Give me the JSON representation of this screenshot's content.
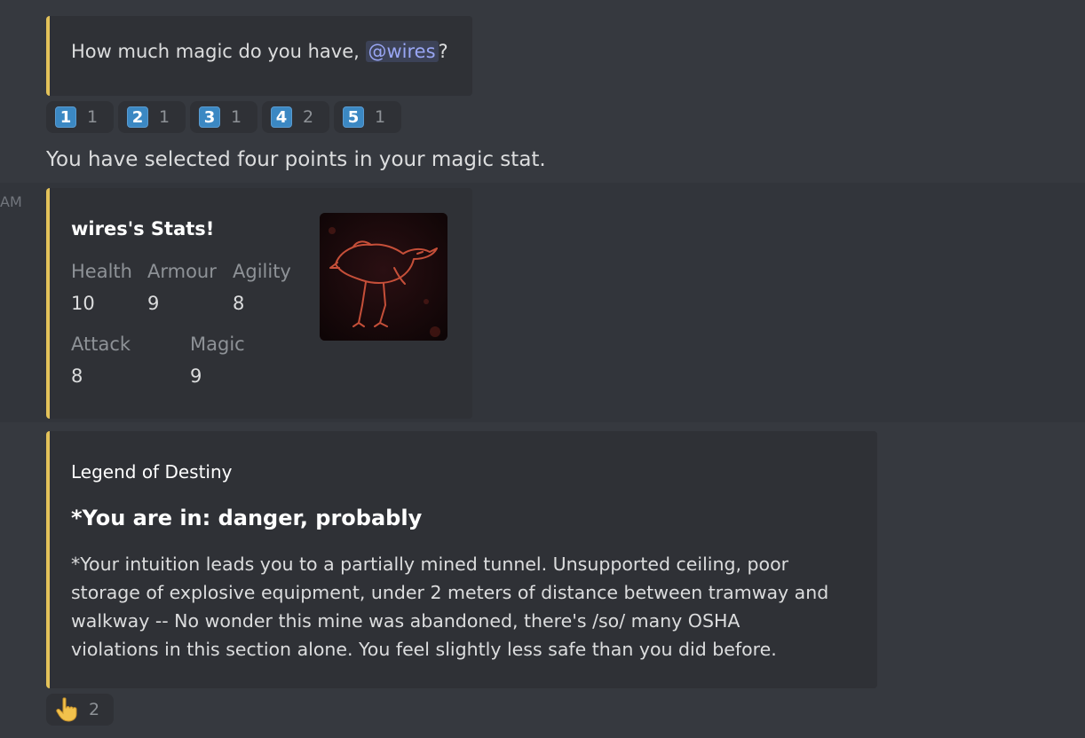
{
  "top_cut_text": "...",
  "question": {
    "text_before": "How much magic do you have, ",
    "mention": "@wires",
    "text_after": "?"
  },
  "number_reactions": [
    {
      "emoji": "1",
      "count": "1"
    },
    {
      "emoji": "2",
      "count": "1"
    },
    {
      "emoji": "3",
      "count": "1"
    },
    {
      "emoji": "4",
      "count": "2"
    },
    {
      "emoji": "5",
      "count": "1"
    }
  ],
  "selection_message": "You have selected four points in your magic stat.",
  "timestamp_partial": "AM",
  "stats_embed": {
    "title": "wires's Stats!",
    "fields": [
      {
        "name": "Health",
        "value": "10"
      },
      {
        "name": "Armour",
        "value": "9"
      },
      {
        "name": "Agility",
        "value": "8"
      },
      {
        "name": "Attack",
        "value": "8"
      },
      {
        "name": "Magic",
        "value": "9"
      }
    ],
    "thumbnail": "bird-drawing"
  },
  "story_embed": {
    "author": "Legend of Destiny",
    "title": "*You are in: danger, probably",
    "description_lines": [
      "*Your intuition leads you to a partially mined tunnel. Unsupported ceiling, poor",
      "storage of explosive equipment, under 2 meters of distance between tramway and",
      "walkway -- No wonder this mine was abandoned, there's /so/ many OSHA",
      "violations in this section alone. You feel slightly less safe than you did before."
    ]
  },
  "bottom_reaction": {
    "emoji": "point-up-hand-icon",
    "count": "2"
  },
  "colors": {
    "background": "#36393f",
    "embed_bg": "#2f3136",
    "embed_accent": "#e3c25a",
    "mention": "#99a6f4"
  }
}
